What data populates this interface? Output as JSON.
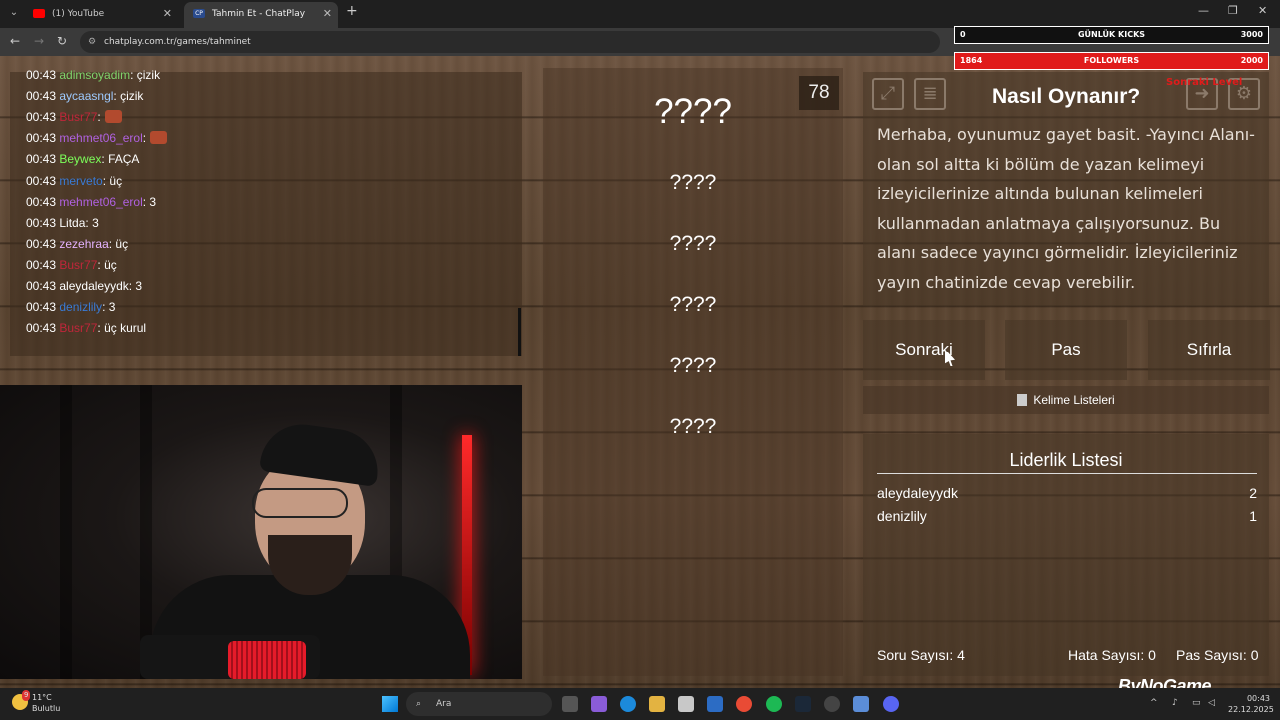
{
  "browser": {
    "tabs": [
      {
        "title": "(1) YouTube"
      },
      {
        "title": "Tahmin Et - ChatPlay",
        "favicon": "CP"
      }
    ],
    "url": "chatplay.com.tr/games/tahminet"
  },
  "overlay": {
    "kicks": {
      "left": "0",
      "label": "GÜNLÜK KICKS",
      "right": "3000"
    },
    "followers": {
      "left": "1864",
      "label": "FOLLOWERS",
      "right": "2000"
    },
    "note": "Sonraki Level"
  },
  "chat": {
    "messages": [
      {
        "time": "00:43",
        "user": "adimsoyadim",
        "color": "#7fd36b",
        "text": ": çizik"
      },
      {
        "time": "00:43",
        "user": "aycaasngl",
        "color": "#9ecbff",
        "text": ": çizik"
      },
      {
        "time": "00:43",
        "user": "Busr77",
        "color": "#c0263a",
        "text": ":",
        "emote": true
      },
      {
        "time": "00:43",
        "user": "mehmet06_erol",
        "color": "#b061e0",
        "text": ":",
        "emote": true
      },
      {
        "time": "00:43",
        "user": "Beywex",
        "color": "#7cff5a",
        "text": ": FAÇA"
      },
      {
        "time": "00:43",
        "user": "merveto",
        "color": "#3a7bd5",
        "text": ": üç"
      },
      {
        "time": "00:43",
        "user": "mehmet06_erol",
        "color": "#b061e0",
        "text": ": 3"
      },
      {
        "time": "00:43",
        "user": "Litda",
        "color": "#ffffff",
        "text": ": 3"
      },
      {
        "time": "00:43",
        "user": "zezehraa",
        "color": "#e6b3ff",
        "text": ": üç"
      },
      {
        "time": "00:43",
        "user": "Busr77",
        "color": "#c0263a",
        "text": ": üç"
      },
      {
        "time": "00:43",
        "user": "aleydaleyydk",
        "color": "#ffffff",
        "text": ": 3"
      },
      {
        "time": "00:43",
        "user": "denizlily",
        "color": "#3a7bd5",
        "text": ": 3"
      },
      {
        "time": "00:43",
        "user": "Busr77",
        "color": "#c0263a",
        "text": ": üç kurul"
      }
    ]
  },
  "game": {
    "counter": "78",
    "main_word": "????",
    "forbidden_words": [
      "????",
      "????",
      "????",
      "????",
      "????"
    ]
  },
  "help": {
    "title": "Nasıl Oynanır?",
    "text": "Merhaba, oyunumuz gayet basit. -Yayıncı Alanı- olan sol altta ki bölüm de yazan kelimeyi izleyicilerinize altında bulunan kelimeleri kullanmadan anlatmaya çalışıyorsunuz. Bu alanı sadece yayıncı görmelidir. İzleyicileriniz yayın chatinizde cevap verebilir."
  },
  "buttons": {
    "next": "Sonraki",
    "pass": "Pas",
    "reset": "Sıfırla",
    "word_lists": "Kelime Listeleri"
  },
  "leaderboard": {
    "title": "Liderlik Listesi",
    "rows": [
      {
        "name": "aleydaleyydk",
        "score": "2"
      },
      {
        "name": "denizlily",
        "score": "1"
      }
    ],
    "stats": {
      "questions": "Soru Sayısı: 4",
      "errors": "Hata Sayısı: 0",
      "passes": "Pas Sayısı: 0"
    }
  },
  "logo": "ByNoGame",
  "taskbar": {
    "weather_temp": "11°C",
    "weather_desc": "Bulutlu",
    "weather_badge": "9",
    "search": "Ara",
    "time": "00:43",
    "date": "22.12.2025"
  }
}
